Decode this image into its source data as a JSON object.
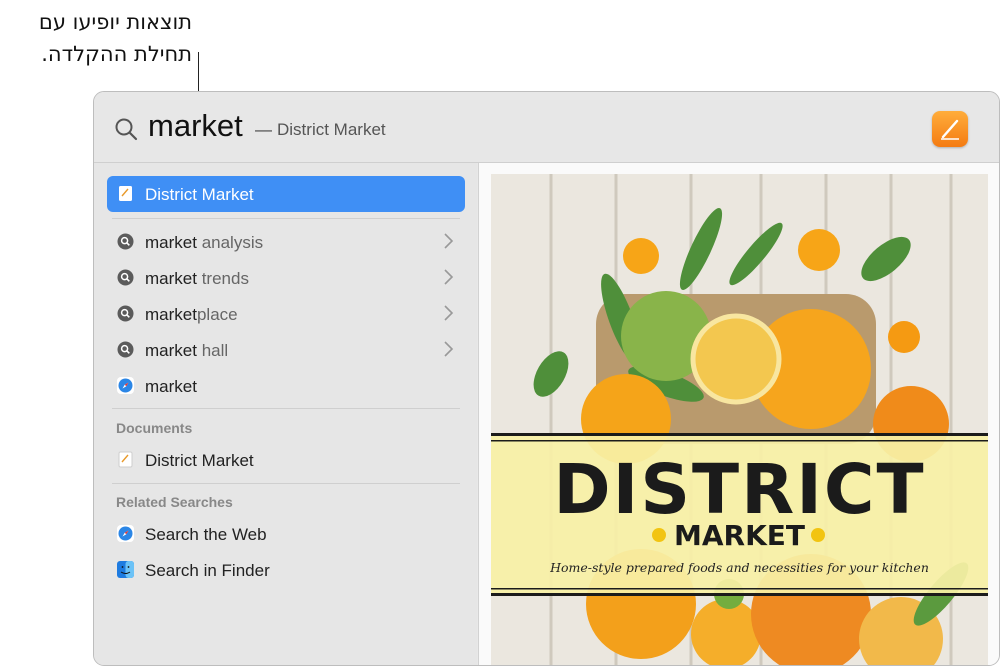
{
  "annotation": {
    "line1": "תוצאות יופיעו עם",
    "line2": "תחילת ההקלדה."
  },
  "search": {
    "query": "market",
    "dash": "—",
    "completion": "District Market",
    "app_icon": "pages-icon"
  },
  "results": {
    "top_hit": {
      "label": "District Market",
      "icon": "document-icon"
    },
    "suggestions": [
      {
        "bold": "market",
        "rest": " analysis",
        "icon": "search-icon"
      },
      {
        "bold": "market",
        "rest": " trends",
        "icon": "search-icon"
      },
      {
        "bold": "market",
        "rest": "place",
        "icon": "search-icon"
      },
      {
        "bold": "market",
        "rest": " hall",
        "icon": "search-icon"
      },
      {
        "bold": "market",
        "rest": "",
        "icon": "safari-icon"
      }
    ],
    "documents_title": "Documents",
    "documents": [
      {
        "label": "District Market",
        "icon": "document-icon"
      }
    ],
    "related_title": "Related Searches",
    "related": [
      {
        "label": "Search the Web",
        "icon": "safari-icon"
      },
      {
        "label": "Search in Finder",
        "icon": "finder-icon"
      }
    ]
  },
  "preview": {
    "title": "DISTRICT",
    "subtitle": "MARKET",
    "tagline": "Home-style prepared foods and necessities for your kitchen"
  }
}
